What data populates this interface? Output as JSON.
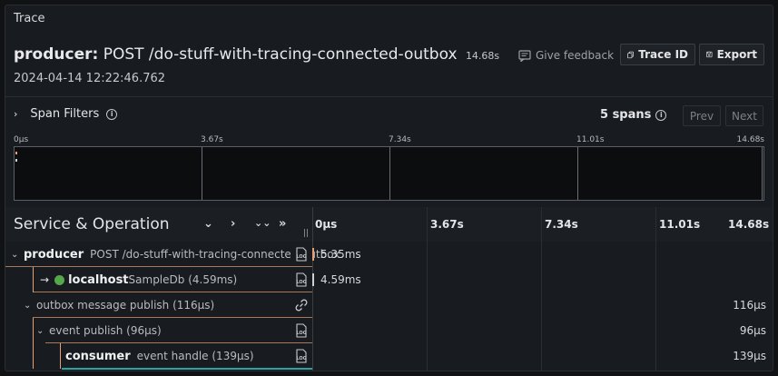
{
  "panel": {
    "title": "Trace"
  },
  "trace": {
    "service": "producer",
    "operation": "POST /do-stuff-with-tracing-connected-outbox",
    "duration": "14.68s",
    "start_time": "2024-04-14 12:22:46.762"
  },
  "toolbar": {
    "feedback_label": "Give feedback",
    "trace_id_label": "Trace ID",
    "export_label": "Export"
  },
  "filters": {
    "label": "Span Filters",
    "span_count": "5 spans",
    "prev_label": "Prev",
    "next_label": "Next"
  },
  "minimap": {
    "ticks": [
      "0μs",
      "3.67s",
      "7.34s",
      "11.01s",
      "14.68s"
    ]
  },
  "timeline": {
    "header_title": "Service & Operation",
    "ticks": [
      "0μs",
      "3.67s",
      "7.34s",
      "11.01s",
      "14.68s"
    ]
  },
  "spans": [
    {
      "service": "producer",
      "operation": "POST /do-stuff-with-tracing-connected-outbox",
      "value": "5.35ms",
      "icon": "log-icon"
    },
    {
      "service": "localhost",
      "operation": "SampleDb (4.59ms)",
      "value": "4.59ms",
      "icon": "log-icon"
    },
    {
      "service": "",
      "operation": "outbox message publish (116μs)",
      "value": "116μs",
      "icon": "link-icon"
    },
    {
      "service": "",
      "operation": "event publish (96μs)",
      "value": "96μs",
      "icon": "log-icon"
    },
    {
      "service": "consumer",
      "operation": "event handle (139μs)",
      "value": "139μs",
      "icon": "log-icon"
    }
  ],
  "colors": {
    "background": "#181b1f",
    "span_indent_line": "#e8a070",
    "consumer_bar": "#2aa3a3",
    "localhost_dot": "#56a64b"
  }
}
